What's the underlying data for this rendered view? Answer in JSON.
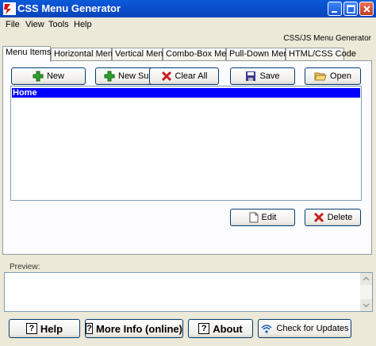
{
  "window": {
    "title": "CSS Menu Generator",
    "brand": "CSS/JS Menu Generator"
  },
  "menubar": [
    "File",
    "View",
    "Tools",
    "Help"
  ],
  "tabs": [
    "Menu Items",
    "Horizontal Menu",
    "Vertical Menu",
    "Combo-Box Menu",
    "Pull-Down Menu",
    "HTML/CSS Code"
  ],
  "toolbar": {
    "new_label": "New",
    "new_sub_label": "New Sub-",
    "clear_all_label": "Clear All",
    "save_label": "Save",
    "open_label": "Open"
  },
  "tree": {
    "items": [
      "Home"
    ]
  },
  "actions": {
    "edit_label": "Edit",
    "delete_label": "Delete"
  },
  "preview": {
    "label": "Preview:"
  },
  "bottom": {
    "help_label": "Help",
    "more_info_label": "More Info (online)",
    "about_label": "About",
    "check_updates_label": "Check for Updates"
  },
  "colors": {
    "titlebar": "#0a4fcf",
    "selection": "#0000ff",
    "window_bg": "#ece9d8"
  }
}
